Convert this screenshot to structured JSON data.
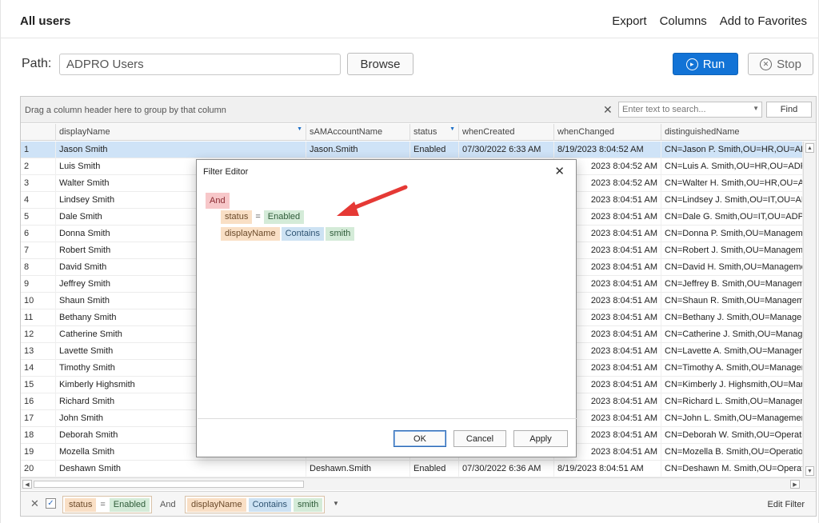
{
  "header": {
    "title": "All users",
    "actions": [
      "Export",
      "Columns",
      "Add to Favorites"
    ]
  },
  "toolbar": {
    "path_label": "Path:",
    "path_value": "ADPRO Users",
    "browse_label": "Browse",
    "run_label": "Run",
    "stop_label": "Stop"
  },
  "grid": {
    "group_hint": "Drag a column header here to group by that column",
    "search_placeholder": "Enter text to search...",
    "find_label": "Find",
    "columns": [
      "displayName",
      "sAMAccountName",
      "status",
      "whenCreated",
      "whenChanged",
      "distinguishedName"
    ],
    "rows": [
      {
        "n": "1",
        "name": "Jason Smith",
        "sam": "Jason.Smith",
        "status": "Enabled",
        "created": "07/30/2022 6:33 AM",
        "changed": "8/19/2023 8:04:52 AM",
        "dn": "CN=Jason P. Smith,OU=HR,OU=AD"
      },
      {
        "n": "2",
        "name": "Luis Smith",
        "sam": "",
        "status": "",
        "created": "",
        "changed": "2023 8:04:52 AM",
        "dn": "CN=Luis A. Smith,OU=HR,OU=ADPF"
      },
      {
        "n": "3",
        "name": "Walter Smith",
        "sam": "",
        "status": "",
        "created": "",
        "changed": "2023 8:04:52 AM",
        "dn": "CN=Walter H. Smith,OU=HR,OU=AD"
      },
      {
        "n": "4",
        "name": "Lindsey Smith",
        "sam": "",
        "status": "",
        "created": "",
        "changed": "2023 8:04:51 AM",
        "dn": "CN=Lindsey J. Smith,OU=IT,OU=AD"
      },
      {
        "n": "5",
        "name": "Dale Smith",
        "sam": "",
        "status": "",
        "created": "",
        "changed": "2023 8:04:51 AM",
        "dn": "CN=Dale G. Smith,OU=IT,OU=ADPR"
      },
      {
        "n": "6",
        "name": "Donna Smith",
        "sam": "",
        "status": "",
        "created": "",
        "changed": "2023 8:04:51 AM",
        "dn": "CN=Donna P. Smith,OU=Manageme"
      },
      {
        "n": "7",
        "name": "Robert Smith",
        "sam": "",
        "status": "",
        "created": "",
        "changed": "2023 8:04:51 AM",
        "dn": "CN=Robert J. Smith,OU=Manageme"
      },
      {
        "n": "8",
        "name": "David Smith",
        "sam": "",
        "status": "",
        "created": "",
        "changed": "2023 8:04:51 AM",
        "dn": "CN=David H. Smith,OU=Managemen"
      },
      {
        "n": "9",
        "name": "Jeffrey Smith",
        "sam": "",
        "status": "",
        "created": "",
        "changed": "2023 8:04:51 AM",
        "dn": "CN=Jeffrey B. Smith,OU=Manageme"
      },
      {
        "n": "10",
        "name": "Shaun Smith",
        "sam": "",
        "status": "",
        "created": "",
        "changed": "2023 8:04:51 AM",
        "dn": "CN=Shaun R. Smith,OU=Manageme"
      },
      {
        "n": "11",
        "name": "Bethany Smith",
        "sam": "",
        "status": "",
        "created": "",
        "changed": "2023 8:04:51 AM",
        "dn": "CN=Bethany J. Smith,OU=Manage"
      },
      {
        "n": "12",
        "name": "Catherine Smith",
        "sam": "",
        "status": "",
        "created": "",
        "changed": "2023 8:04:51 AM",
        "dn": "CN=Catherine J. Smith,OU=Manage"
      },
      {
        "n": "13",
        "name": "Lavette Smith",
        "sam": "",
        "status": "",
        "created": "",
        "changed": "2023 8:04:51 AM",
        "dn": "CN=Lavette A. Smith,OU=Managem"
      },
      {
        "n": "14",
        "name": "Timothy Smith",
        "sam": "",
        "status": "",
        "created": "",
        "changed": "2023 8:04:51 AM",
        "dn": "CN=Timothy A. Smith,OU=Managem"
      },
      {
        "n": "15",
        "name": "Kimberly Highsmith",
        "sam": "",
        "status": "",
        "created": "",
        "changed": "2023 8:04:51 AM",
        "dn": "CN=Kimberly J. Highsmith,OU=Mana"
      },
      {
        "n": "16",
        "name": "Richard Smith",
        "sam": "",
        "status": "",
        "created": "",
        "changed": "2023 8:04:51 AM",
        "dn": "CN=Richard L. Smith,OU=Manageme"
      },
      {
        "n": "17",
        "name": "John Smith",
        "sam": "",
        "status": "",
        "created": "",
        "changed": "2023 8:04:51 AM",
        "dn": "CN=John L. Smith,OU=Management"
      },
      {
        "n": "18",
        "name": "Deborah Smith",
        "sam": "",
        "status": "",
        "created": "",
        "changed": "2023 8:04:51 AM",
        "dn": "CN=Deborah W. Smith,OU=Operatic"
      },
      {
        "n": "19",
        "name": "Mozella Smith",
        "sam": "",
        "status": "",
        "created": "",
        "changed": "2023 8:04:51 AM",
        "dn": "CN=Mozella B. Smith,OU=Operation"
      },
      {
        "n": "20",
        "name": "Deshawn Smith",
        "sam": "Deshawn.Smith",
        "status": "Enabled",
        "created": "07/30/2022 6:36 AM",
        "changed": "8/19/2023 8:04:51 AM",
        "dn": "CN=Deshawn M. Smith,OU=Operati"
      }
    ]
  },
  "filter_bar": {
    "field1": "status",
    "op1": "=",
    "value1": "Enabled",
    "joiner": "And",
    "field2": "displayName",
    "op2": "Contains",
    "value2": "smith",
    "edit_label": "Edit Filter"
  },
  "dialog": {
    "title": "Filter Editor",
    "group_op": "And",
    "cond1": {
      "field": "status",
      "op": "=",
      "value": "Enabled"
    },
    "cond2": {
      "field": "displayName",
      "op": "Contains",
      "value": "smith"
    },
    "ok_label": "OK",
    "cancel_label": "Cancel",
    "apply_label": "Apply"
  },
  "colors": {
    "run_button": "#1273d6",
    "selected_row": "#cfe3f7",
    "annotation_arrow": "#e53935"
  }
}
